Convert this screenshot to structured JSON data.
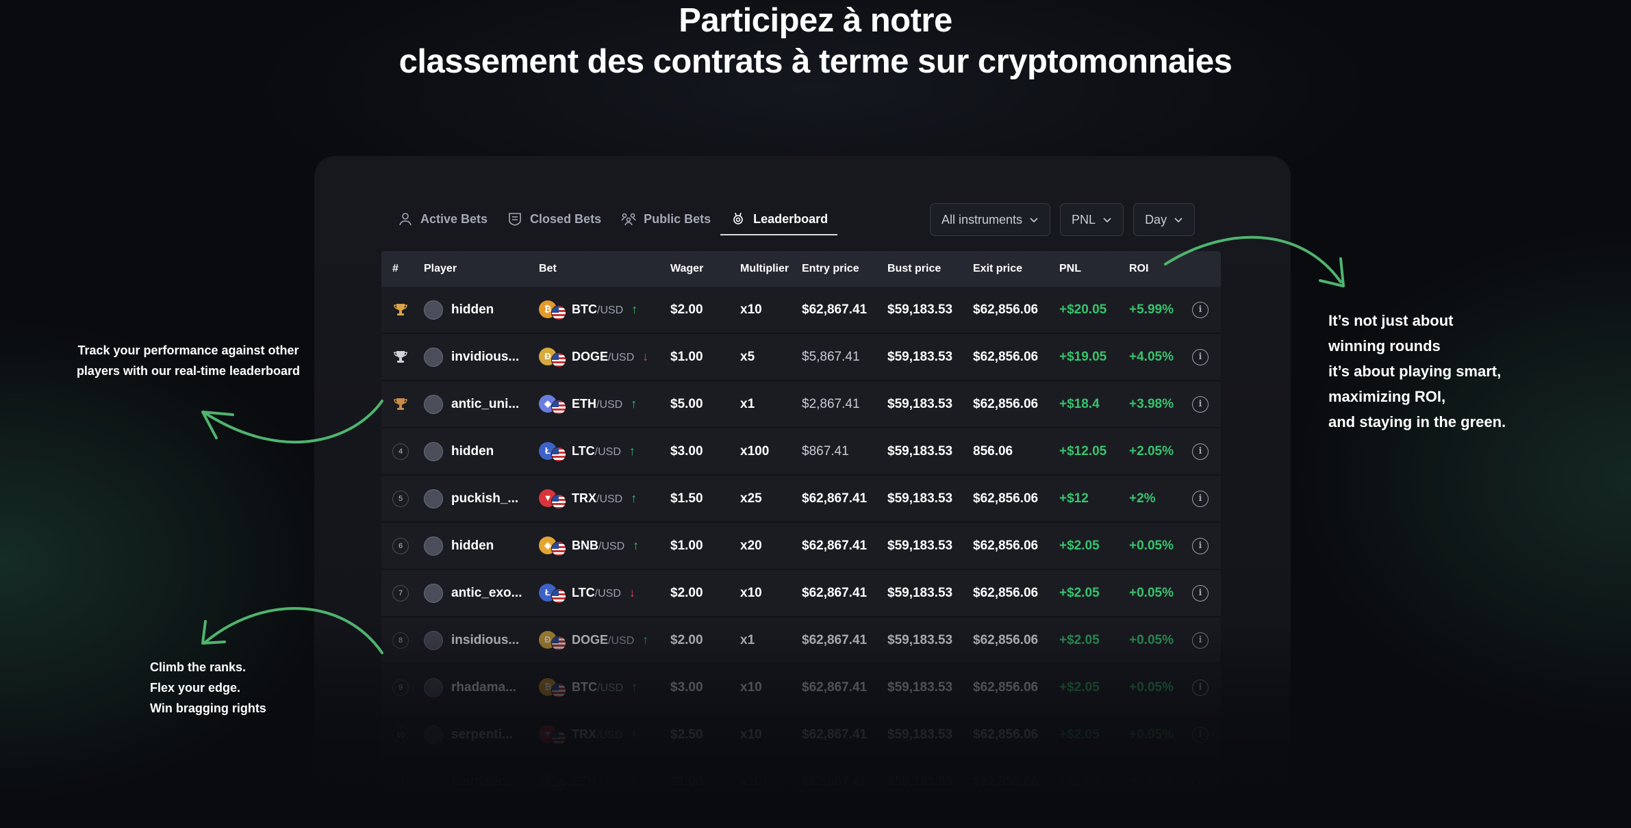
{
  "headline": {
    "line1": "Participez à notre",
    "line2": "classement des contrats à terme sur cryptomonnaies"
  },
  "tabs": [
    {
      "label": "Active Bets",
      "icon": "user-icon"
    },
    {
      "label": "Closed Bets",
      "icon": "shield-list-icon"
    },
    {
      "label": "Public Bets",
      "icon": "people-icon"
    },
    {
      "label": "Leaderboard",
      "icon": "trophy-icon",
      "active": true
    }
  ],
  "filters": {
    "instruments": "All instruments",
    "metric": "PNL",
    "period": "Day"
  },
  "columns": [
    "#",
    "Player",
    "Bet",
    "Wager",
    "Multiplier",
    "Entry price",
    "Bust price",
    "Exit price",
    "PNL",
    "ROI"
  ],
  "rows": [
    {
      "rank": "",
      "medal": "gold",
      "player": "hidden",
      "coin": "BTC",
      "coin_color": "#e39a2a",
      "coin_glyph": "₿",
      "pair": "/USD",
      "dir": "up",
      "dir_glyph": "↑",
      "wager": "$2.00",
      "mult": "x10",
      "entry": "$62,867.41",
      "bust": "$59,183.53",
      "exit": "$62,856.06",
      "pnl": "+$20.05",
      "roi": "+5.99%"
    },
    {
      "rank": "",
      "medal": "silver",
      "player": "invidious...",
      "coin": "DOGE",
      "coin_color": "#d7a93c",
      "coin_glyph": "Ð",
      "pair": "/USD",
      "dir": "down",
      "dir_glyph": "↓",
      "wager": "$1.00",
      "mult": "x5",
      "entry": "$5,867.41",
      "bust": "$59,183.53",
      "exit": "$62,856.06",
      "pnl": "+$19.05",
      "roi": "+4.05%"
    },
    {
      "rank": "",
      "medal": "bronze",
      "player": "antic_uni...",
      "coin": "ETH",
      "coin_color": "#6a7ce0",
      "coin_glyph": "◆",
      "pair": "/USD",
      "dir": "up",
      "dir_glyph": "↑",
      "wager": "$5.00",
      "mult": "x1",
      "entry": "$2,867.41",
      "bust": "$59,183.53",
      "exit": "$62,856.06",
      "pnl": "+$18.4",
      "roi": "+3.98%"
    },
    {
      "rank": "4",
      "medal": "",
      "player": "hidden",
      "coin": "LTC",
      "coin_color": "#3d63c9",
      "coin_glyph": "Ł",
      "pair": "/USD",
      "dir": "up",
      "dir_glyph": "↑",
      "wager": "$3.00",
      "mult": "x100",
      "entry": "$867.41",
      "bust": "$59,183.53",
      "exit": "856.06",
      "pnl": "+$12.05",
      "roi": "+2.05%"
    },
    {
      "rank": "5",
      "medal": "",
      "player": "puckish_...",
      "coin": "TRX",
      "coin_color": "#d8353a",
      "coin_glyph": "▼",
      "pair": "/USD",
      "dir": "up",
      "dir_glyph": "↑",
      "wager": "$1.50",
      "mult": "x25",
      "entry": "$62,867.41",
      "bust": "$59,183.53",
      "exit": "$62,856.06",
      "pnl": "+$12",
      "roi": "+2%"
    },
    {
      "rank": "6",
      "medal": "",
      "player": "hidden",
      "coin": "BNB",
      "coin_color": "#e3a531",
      "coin_glyph": "◈",
      "pair": "/USD",
      "dir": "up",
      "dir_glyph": "↑",
      "wager": "$1.00",
      "mult": "x20",
      "entry": "$62,867.41",
      "bust": "$59,183.53",
      "exit": "$62,856.06",
      "pnl": "+$2.05",
      "roi": "+0.05%"
    },
    {
      "rank": "7",
      "medal": "",
      "player": "antic_exo...",
      "coin": "LTC",
      "coin_color": "#3d63c9",
      "coin_glyph": "Ł",
      "pair": "/USD",
      "dir": "down",
      "dir_glyph": "↓",
      "wager": "$2.00",
      "mult": "x10",
      "entry": "$62,867.41",
      "bust": "$59,183.53",
      "exit": "$62,856.06",
      "pnl": "+$2.05",
      "roi": "+0.05%"
    },
    {
      "rank": "8",
      "medal": "",
      "player": "insidious...",
      "coin": "DOGE",
      "coin_color": "#d7a93c",
      "coin_glyph": "Ð",
      "pair": "/USD",
      "dir": "up",
      "dir_glyph": "↑",
      "wager": "$2.00",
      "mult": "x1",
      "entry": "$62,867.41",
      "bust": "$59,183.53",
      "exit": "$62,856.06",
      "pnl": "+$2.05",
      "roi": "+0.05%"
    },
    {
      "rank": "9",
      "medal": "",
      "player": "rhadama...",
      "coin": "BTC",
      "coin_color": "#e39a2a",
      "coin_glyph": "₿",
      "pair": "/USD",
      "dir": "up",
      "dir_glyph": "↑",
      "wager": "$3.00",
      "mult": "x10",
      "entry": "$62,867.41",
      "bust": "$59,183.53",
      "exit": "$62,856.06",
      "pnl": "+$2.05",
      "roi": "+0.05%"
    },
    {
      "rank": "10",
      "medal": "",
      "player": "serpenti...",
      "coin": "TRX",
      "coin_color": "#d8353a",
      "coin_glyph": "▼",
      "pair": "/USD",
      "dir": "up",
      "dir_glyph": "↑",
      "wager": "$2.50",
      "mult": "x10",
      "entry": "$62,867.41",
      "bust": "$59,183.53",
      "exit": "$62,856.06",
      "pnl": "+$2.05",
      "roi": "+0.05%"
    },
    {
      "rank": "11",
      "medal": "",
      "player": "heuristic...",
      "coin": "ETH",
      "coin_color": "#6a7ce0",
      "coin_glyph": "◆",
      "pair": "/USD",
      "dir": "up",
      "dir_glyph": "↑",
      "wager": "$1.00",
      "mult": "x10",
      "entry": "$62,867.41",
      "bust": "$59,183.53",
      "exit": "$62,856.06",
      "pnl": "+$2.05",
      "roi": "+0.05%"
    }
  ],
  "notes": {
    "left_top": "Track your performance against other players with our real-time leaderboard",
    "left_bottom": [
      "Climb the ranks.",
      "Flex your edge.",
      "Win bragging rights"
    ],
    "right": [
      "It’s not just about",
      "winning rounds",
      "it’s about playing smart,",
      "maximizing ROI,",
      "and staying in the green."
    ]
  },
  "colors": {
    "accent_green": "#37c46d",
    "arrow_green": "#4fb46e",
    "panel": "#17181e"
  }
}
